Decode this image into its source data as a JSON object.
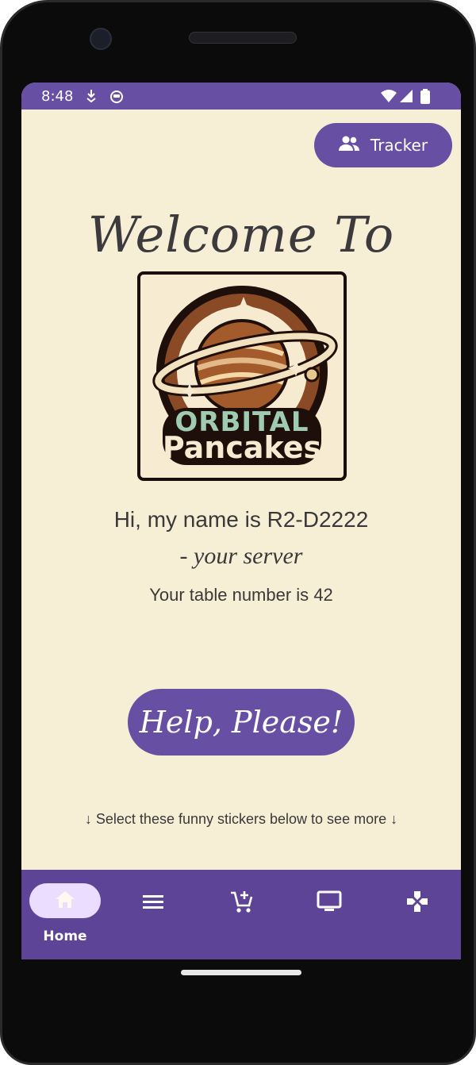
{
  "status": {
    "time": "8:48"
  },
  "header": {
    "tracker_label": "Tracker"
  },
  "main": {
    "welcome": "Welcome To",
    "logo_text": {
      "line1": "ORBITAL",
      "line2": "Pancakes"
    },
    "greeting_prefix": "Hi, my name is",
    "server_name": "R2-D2222",
    "server_role": "- your server",
    "table_prefix": "Your table number is",
    "table_number": "42",
    "help_label": "Help, Please!",
    "hint": "↓ Select these funny stickers below to see more ↓"
  },
  "nav": {
    "items": [
      {
        "label": "Home",
        "icon": "home-icon"
      },
      {
        "label": "",
        "icon": "menu-icon"
      },
      {
        "label": "",
        "icon": "add-cart-icon"
      },
      {
        "label": "",
        "icon": "tv-icon"
      },
      {
        "label": "",
        "icon": "gamepad-icon"
      }
    ],
    "selected": 0
  },
  "colors": {
    "primary": "#6750a4",
    "nav": "#5e4496",
    "background": "#f6efd6",
    "pill": "#eaddff"
  }
}
